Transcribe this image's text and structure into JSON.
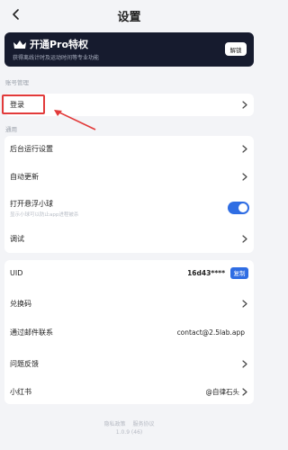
{
  "header": {
    "title": "设置"
  },
  "pro_banner": {
    "title": "开通Pro特权",
    "subtitle": "获得离线计时及运动时间等专业功能",
    "button_label": "解锁"
  },
  "account_section": {
    "label": "账号管理",
    "items": [
      {
        "label": "登录"
      }
    ]
  },
  "general_section": {
    "label": "通用",
    "items": [
      {
        "label": "后台运行设置"
      },
      {
        "label": "自动更新"
      },
      {
        "label": "打开悬浮小球",
        "sub": "显示小球可以防止app进程被杀",
        "toggle_on": true
      },
      {
        "label": "调试"
      }
    ]
  },
  "info_section": {
    "uid": {
      "label": "UID",
      "value": "16d43****",
      "button_label": "复制"
    },
    "redeem": {
      "label": "兑换码"
    },
    "email": {
      "label": "通过邮件联系",
      "value": "contact@2.5lab.app"
    },
    "feedback": {
      "label": "问题反馈"
    },
    "xiaohongshu": {
      "label": "小红书",
      "value": "@自律石头"
    }
  },
  "footer": {
    "privacy": "隐私政策",
    "terms": "服务协议",
    "version": "1.0.9 (46)"
  },
  "colors": {
    "accent": "#2f6de3",
    "banner_bg": "#161b2e",
    "highlight": "#e23a3a",
    "page_bg": "#f3f4f7"
  }
}
